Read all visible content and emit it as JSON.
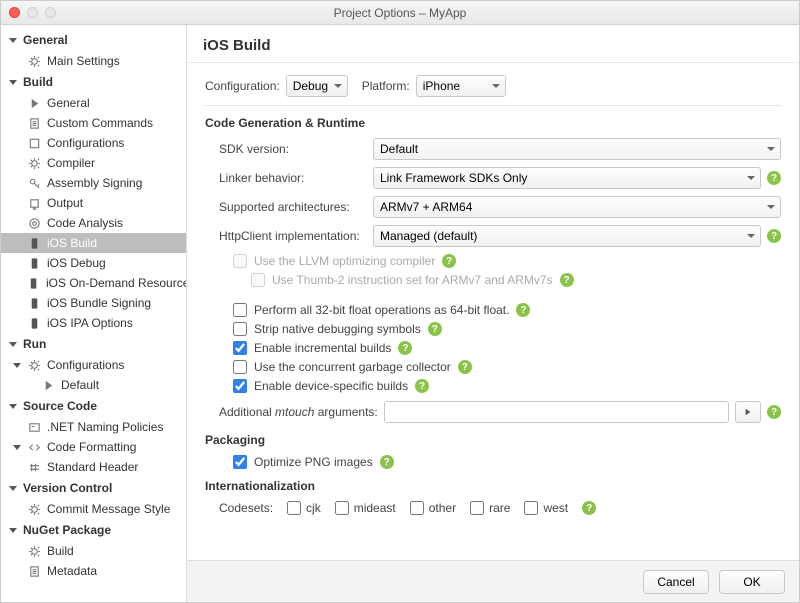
{
  "window": {
    "title": "Project Options – MyApp"
  },
  "sidebar": {
    "groups": [
      {
        "label": "General",
        "items": [
          {
            "label": "Main Settings",
            "icon": "gear"
          }
        ]
      },
      {
        "label": "Build",
        "items": [
          {
            "label": "General",
            "icon": "play"
          },
          {
            "label": "Custom Commands",
            "icon": "doc"
          },
          {
            "label": "Configurations",
            "icon": "box"
          },
          {
            "label": "Compiler",
            "icon": "gear"
          },
          {
            "label": "Assembly Signing",
            "icon": "key"
          },
          {
            "label": "Output",
            "icon": "output"
          },
          {
            "label": "Code Analysis",
            "icon": "target"
          },
          {
            "label": "iOS Build",
            "icon": "phone",
            "selected": true
          },
          {
            "label": "iOS Debug",
            "icon": "phone"
          },
          {
            "label": "iOS On-Demand Resources",
            "icon": "phone"
          },
          {
            "label": "iOS Bundle Signing",
            "icon": "phone"
          },
          {
            "label": "iOS IPA Options",
            "icon": "phone"
          }
        ]
      },
      {
        "label": "Run",
        "items": [
          {
            "label": "Configurations",
            "icon": "gear",
            "expandable": true,
            "children": [
              {
                "label": "Default",
                "icon": "play"
              }
            ]
          }
        ]
      },
      {
        "label": "Source Code",
        "items": [
          {
            "label": ".NET Naming Policies",
            "icon": "card"
          },
          {
            "label": "Code Formatting",
            "icon": "chevrons",
            "expandable": true
          },
          {
            "label": "Standard Header",
            "icon": "hash"
          }
        ]
      },
      {
        "label": "Version Control",
        "items": [
          {
            "label": "Commit Message Style",
            "icon": "gear"
          }
        ]
      },
      {
        "label": "NuGet Package",
        "items": [
          {
            "label": "Build",
            "icon": "gear"
          },
          {
            "label": "Metadata",
            "icon": "doc"
          }
        ]
      }
    ]
  },
  "page": {
    "title": "iOS Build",
    "config_label": "Configuration:",
    "config_value": "Debug",
    "platform_label": "Platform:",
    "platform_value": "iPhone",
    "section_codegen": "Code Generation & Runtime",
    "sdk_label": "SDK version:",
    "sdk_value": "Default",
    "linker_label": "Linker behavior:",
    "linker_value": "Link Framework SDKs Only",
    "arch_label": "Supported architectures:",
    "arch_value": "ARMv7 + ARM64",
    "http_label": "HttpClient implementation:",
    "http_value": "Managed (default)",
    "chk_llvm": "Use the LLVM optimizing compiler",
    "chk_thumb": "Use Thumb-2 instruction set for ARMv7 and ARMv7s",
    "chk_float": "Perform all 32-bit float operations as 64-bit float.",
    "chk_strip": "Strip native debugging symbols",
    "chk_incremental": "Enable incremental builds",
    "chk_gc": "Use the concurrent garbage collector",
    "chk_devspec": "Enable device-specific builds",
    "mtouch_label_a": "Additional ",
    "mtouch_label_b": "mtouch",
    "mtouch_label_c": " arguments:",
    "section_packaging": "Packaging",
    "chk_png": "Optimize PNG images",
    "section_i18n": "Internationalization",
    "codesets_label": "Codesets:",
    "codesets": [
      "cjk",
      "mideast",
      "other",
      "rare",
      "west"
    ]
  },
  "footer": {
    "cancel": "Cancel",
    "ok": "OK"
  }
}
